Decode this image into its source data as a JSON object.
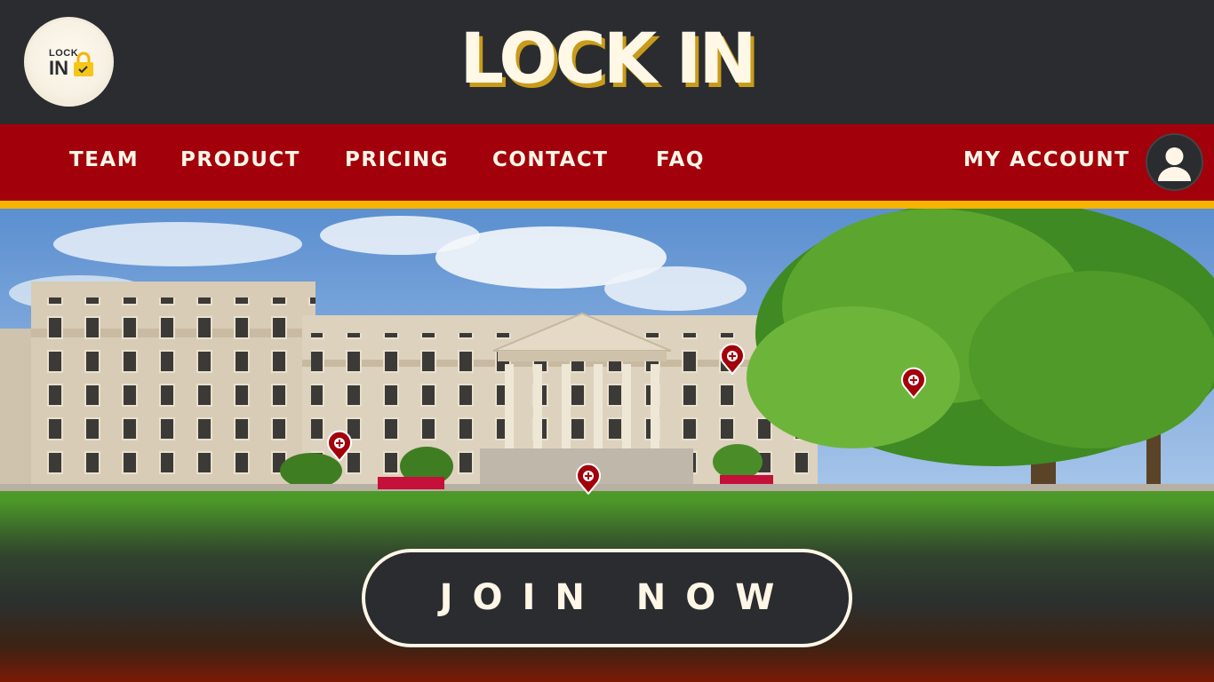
{
  "header": {
    "logo": {
      "top_text": "LOCK",
      "bottom_text": "IN"
    },
    "title": "LOCK IN"
  },
  "nav": {
    "items": [
      {
        "label": "TEAM"
      },
      {
        "label": "PRODUCT"
      },
      {
        "label": "PRICING"
      },
      {
        "label": "CONTACT"
      },
      {
        "label": "FAQ"
      }
    ],
    "account_label": "MY ACCOUNT",
    "avatar_icon": "user-avatar-icon"
  },
  "hero": {
    "image": "campus-building-photo",
    "map_pin_icon": "location-pin-icon",
    "cta_label": "JOIN NOW"
  },
  "colors": {
    "header_bg": "#2b2c30",
    "nav_bg": "#a2000a",
    "accent_stripe": "#f5b400",
    "title_shadow": "#c89b1a",
    "text_light": "#fff6e8"
  }
}
